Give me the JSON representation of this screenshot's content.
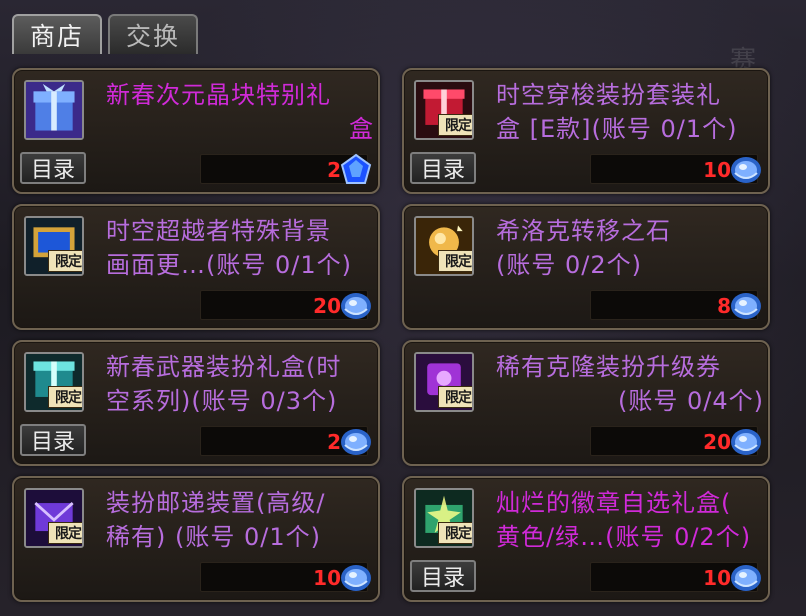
{
  "tabs": [
    {
      "label": "商店",
      "active": true
    },
    {
      "label": "交换",
      "active": false
    }
  ],
  "items": [
    {
      "name_lines": [
        "新春次元晶块特别礼",
        "盒"
      ],
      "color": "#d02ad8",
      "catalog": "目录",
      "limited": "",
      "price": "2",
      "currency": "gem",
      "icon": "gift-box-icon"
    },
    {
      "name_lines": [
        "时空穿梭装扮套装礼",
        "盒 [E款](账号 0/1个)"
      ],
      "color": "#b76ddd",
      "catalog": "目录",
      "limited": "限定",
      "price": "10",
      "currency": "coin",
      "icon": "red-gift-box-icon"
    },
    {
      "name_lines": [
        "时空超越者特殊背景",
        "画面更…(账号 0/1个)"
      ],
      "color": "#b76ddd",
      "catalog": "",
      "limited": "限定",
      "price": "20",
      "currency": "coin",
      "icon": "background-frame-icon"
    },
    {
      "name_lines": [
        "希洛克转移之石",
        "(账号 0/2个)"
      ],
      "color": "#b76ddd",
      "catalog": "",
      "limited": "限定",
      "price": "8",
      "currency": "coin",
      "icon": "transfer-stone-icon"
    },
    {
      "name_lines": [
        "新春武器装扮礼盒(时",
        "空系列)(账号 0/3个)"
      ],
      "color": "#b76ddd",
      "catalog": "目录",
      "limited": "限定",
      "price": "2",
      "currency": "coin",
      "icon": "weapon-box-icon"
    },
    {
      "name_lines": [
        "稀有克隆装扮升级券",
        "(账号 0/4个)"
      ],
      "color": "#b76ddd",
      "catalog": "",
      "limited": "限定",
      "price": "20",
      "currency": "coin",
      "icon": "upgrade-ticket-icon"
    },
    {
      "name_lines": [
        "装扮邮递装置(高级/",
        "稀有) (账号 0/1个)"
      ],
      "color": "#b76ddd",
      "catalog": "",
      "limited": "限定",
      "price": "10",
      "currency": "coin",
      "icon": "mail-device-icon"
    },
    {
      "name_lines": [
        "灿烂的徽章自选礼盒(",
        "黄色/绿…(账号 0/2个)"
      ],
      "color": "#d02ad8",
      "catalog": "目录",
      "limited": "限定",
      "price": "10",
      "currency": "coin",
      "icon": "emblem-box-icon"
    }
  ]
}
